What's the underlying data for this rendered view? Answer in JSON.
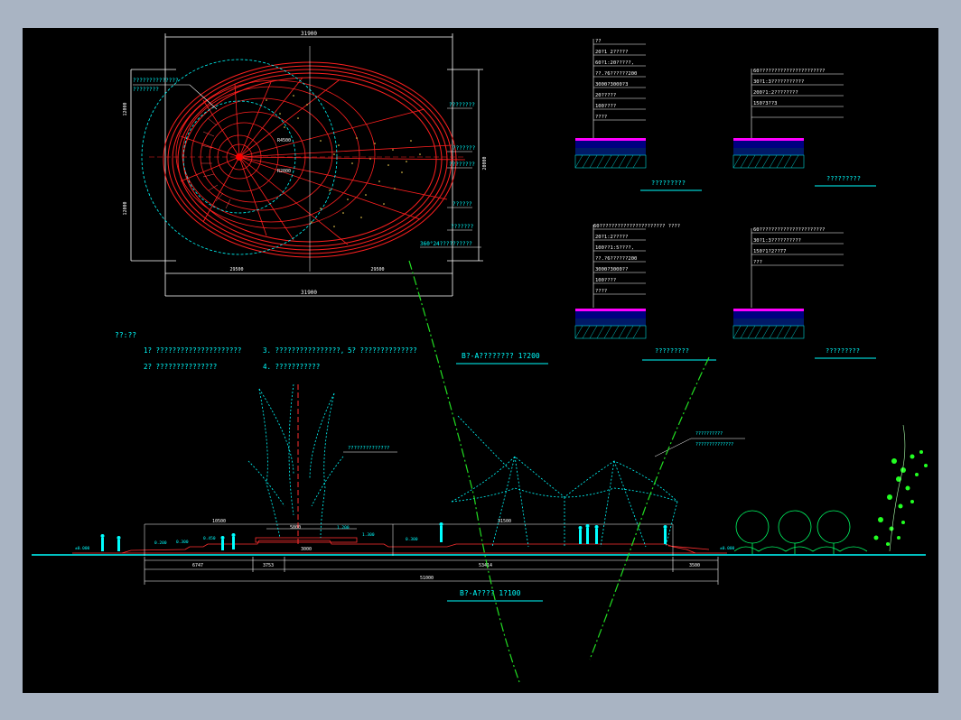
{
  "plan": {
    "dims": {
      "top": "31900",
      "bottom": "31900",
      "left_upper": "12000",
      "left_lower": "12000",
      "right": "20000",
      "bottom_left": "29500",
      "bottom_right": "29500",
      "r1": "R4500",
      "r2": "R2000"
    },
    "left_label_1": "??????????????",
    "left_label_2": "????????",
    "right_labels": [
      "????????",
      "???????",
      "????????",
      "??????",
      "???????",
      "360°24??????????"
    ]
  },
  "sections": [
    {
      "lines": [
        "??",
        "20?1 2?????",
        "60?1:20?????,",
        "??.?6??????200",
        "3000?3000?3",
        "20?????",
        "100????",
        "????"
      ],
      "title": "?????????"
    },
    {
      "lines": [
        "60??????????????????????",
        "30?1:3???????????",
        "200?1:2????????",
        "150?3??3",
        ""
      ],
      "title": "?????????"
    },
    {
      "lines": [
        "60??????????????????????    ????",
        "20?1:2?????",
        "100??1:5????,",
        "??.?6??????200",
        "3000?3000??",
        "100????",
        "????"
      ],
      "title": "?????????"
    },
    {
      "lines": [
        "60??????????????????????",
        "30?1:3??????????",
        "150?1?2??77",
        "???"
      ],
      "title": "?????????"
    }
  ],
  "notes": {
    "heading": "??:??",
    "item1": "1?  ?????????????????????",
    "item3": "3.  ????????????????,",
    "item5": "5?  ??????????????",
    "item2": "2?  ???????????????",
    "item4": "4.  ???????????"
  },
  "plan_title": "B?-A????????    1?200",
  "elevation": {
    "label_sculpture": "??????????????",
    "label_tent_1": "??????????",
    "label_tent_2": "??????????????",
    "dim_top_left": "10500",
    "dim_top_mid": "5000",
    "dim_top_right": "31500",
    "dim_center": "3000",
    "level_1": "±0.000",
    "level_2": "0.200",
    "level_3": "0.300",
    "level_4": "0.450",
    "level_5": "1.200",
    "level_6": "1.300",
    "level_7": "0.300",
    "level_8": "±0.000",
    "dim_b1": "6747",
    "dim_b2": "3753",
    "dim_b3": "53414",
    "dim_b4": "3500",
    "dim_total": "51000",
    "title": "B?-A????    1?100"
  }
}
